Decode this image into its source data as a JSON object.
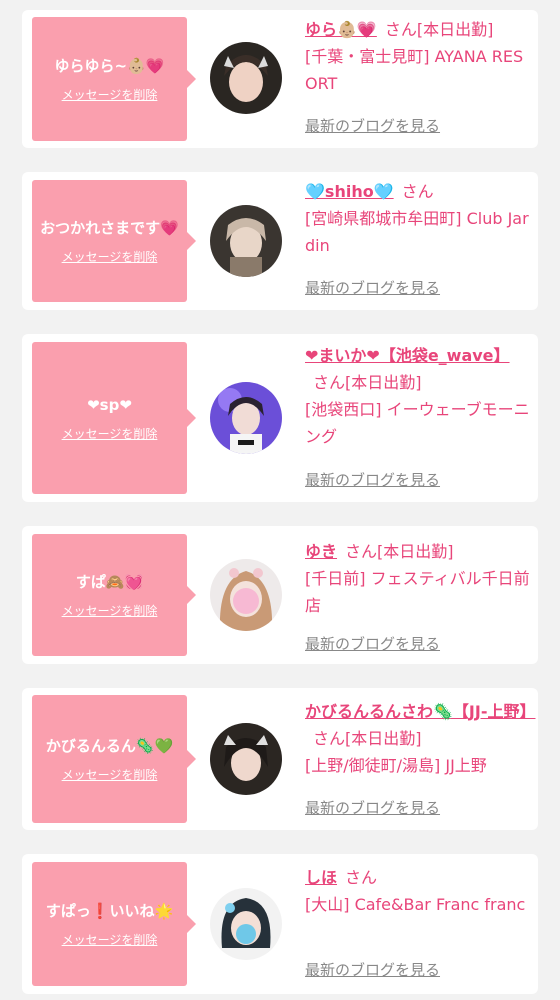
{
  "delete_label": "メッセージを削除",
  "blog_label": "最新のブログを見る",
  "san_label": "さん",
  "items": [
    {
      "message": "ゆらゆら~👶🏼💗",
      "name": "ゆら👶🏼💗",
      "status": "[本日出勤]",
      "shop": "[千葉・富士見町] AYANA RESORT"
    },
    {
      "message": "おつかれさまです💗",
      "name": "🩵shiho🩵",
      "status": "",
      "shop": "[宮崎県都城市牟田町] Club Jardin"
    },
    {
      "message": "❤sp❤",
      "name": "❤まいか❤【池袋e_wave】",
      "status": "[本日出勤]",
      "shop": "[池袋西口] イーウェーブモーニング"
    },
    {
      "message": "すぱ🙈💓",
      "name": "ゆき",
      "status": "[本日出勤]",
      "shop": "[千日前] フェスティバル千日前店"
    },
    {
      "message": "かびるんるん🦠💚",
      "name": "かびるんるんさわ🦠【JJ-上野】",
      "status": "[本日出勤]",
      "shop": "[上野/御徒町/湯島] JJ上野"
    },
    {
      "message": "すぱっ❗️いいね🌟",
      "name": "しほ",
      "status": "",
      "shop": "[大山] Cafe&Bar Franc franc"
    }
  ]
}
